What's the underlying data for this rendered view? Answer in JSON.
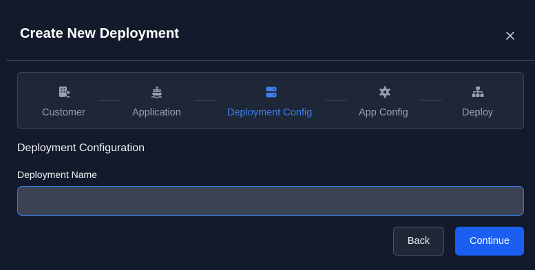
{
  "dialog": {
    "title": "Create New Deployment",
    "close_icon": "close-icon"
  },
  "stepper": {
    "steps": [
      {
        "label": "Customer",
        "icon": "building-user-icon",
        "active": false
      },
      {
        "label": "Application",
        "icon": "ferry-icon",
        "active": false
      },
      {
        "label": "Deployment Config",
        "icon": "server-icon",
        "active": true
      },
      {
        "label": "App Config",
        "icon": "gear-icon",
        "active": false
      },
      {
        "label": "Deploy",
        "icon": "network-icon",
        "active": false
      }
    ],
    "active_color": "#3d7ff0",
    "inactive_color": "#9aa2b1"
  },
  "form": {
    "section_title": "Deployment Configuration",
    "deployment_name_label": "Deployment Name",
    "deployment_name_value": "",
    "deployment_name_placeholder": ""
  },
  "actions": {
    "back_label": "Back",
    "continue_label": "Continue"
  },
  "colors": {
    "background": "#131a2b",
    "primary": "#1a5ff2",
    "input_focus_border": "#3b78e7"
  }
}
